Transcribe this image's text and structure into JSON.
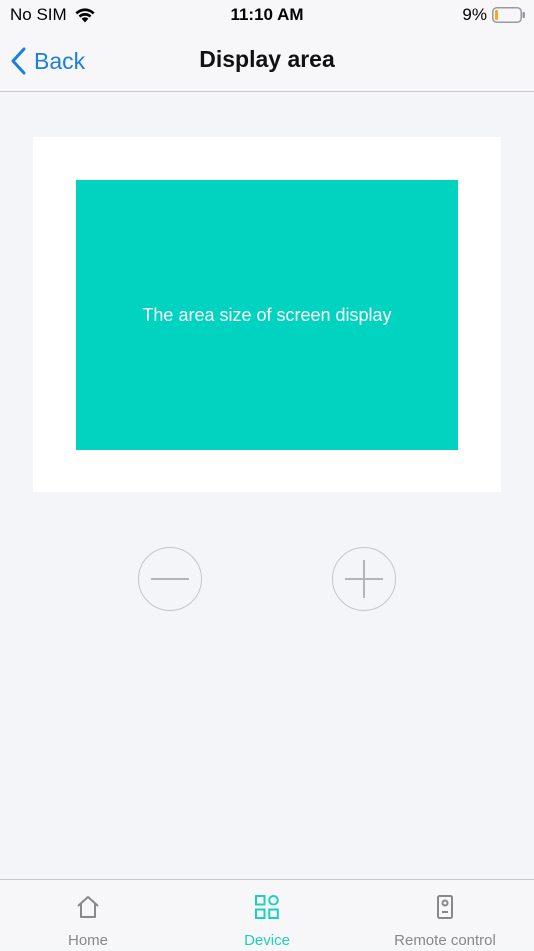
{
  "status_bar": {
    "carrier": "No SIM",
    "time": "11:10 AM",
    "battery": "9%"
  },
  "nav": {
    "back_label": "Back",
    "title": "Display area"
  },
  "display": {
    "caption": "The area size of screen display",
    "accent_color": "#00d4c0"
  },
  "controls": {
    "decrease_icon": "minus-icon",
    "increase_icon": "plus-icon"
  },
  "tabs": [
    {
      "label": "Home",
      "icon": "home-icon",
      "active": false
    },
    {
      "label": "Device",
      "icon": "grid-icon",
      "active": true
    },
    {
      "label": "Remote control",
      "icon": "remote-icon",
      "active": false
    }
  ]
}
